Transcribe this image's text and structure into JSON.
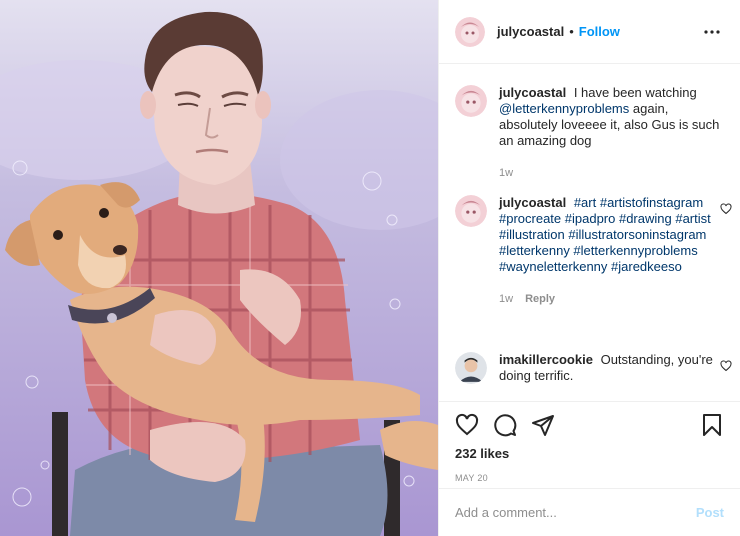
{
  "post": {
    "username": "julycoastal",
    "separator": "•",
    "follow_label": "Follow",
    "more_icon": "more-options-icon"
  },
  "comments": [
    {
      "username": "julycoastal",
      "mention": "@letterkennyproblems",
      "text_before": "I have been watching",
      "text_after": "again, absolutely loveeee it, also Gus is such an amazing dog",
      "time": "1w"
    },
    {
      "username": "julycoastal",
      "hashtags": "#art #artistofinstagram #procreate #ipadpro #drawing #artist #illustration #illustratorsoninstagram #letterkenny #letterkennyproblems #wayneletterkenny #jaredkeeso",
      "time": "1w",
      "reply_label": "Reply"
    },
    {
      "username": "imakillercookie",
      "text": "Outstanding, you're doing terrific."
    }
  ],
  "actions": {
    "likes": "232 likes",
    "date": "MAY 20"
  },
  "add_comment": {
    "placeholder": "Add a comment...",
    "post_label": "Post"
  },
  "colors": {
    "link_blue": "#0095f6",
    "post_disabled": "#b2dffc",
    "mention": "#00376b",
    "art_background": "#b9abd9",
    "shirt": "#d2777c"
  }
}
